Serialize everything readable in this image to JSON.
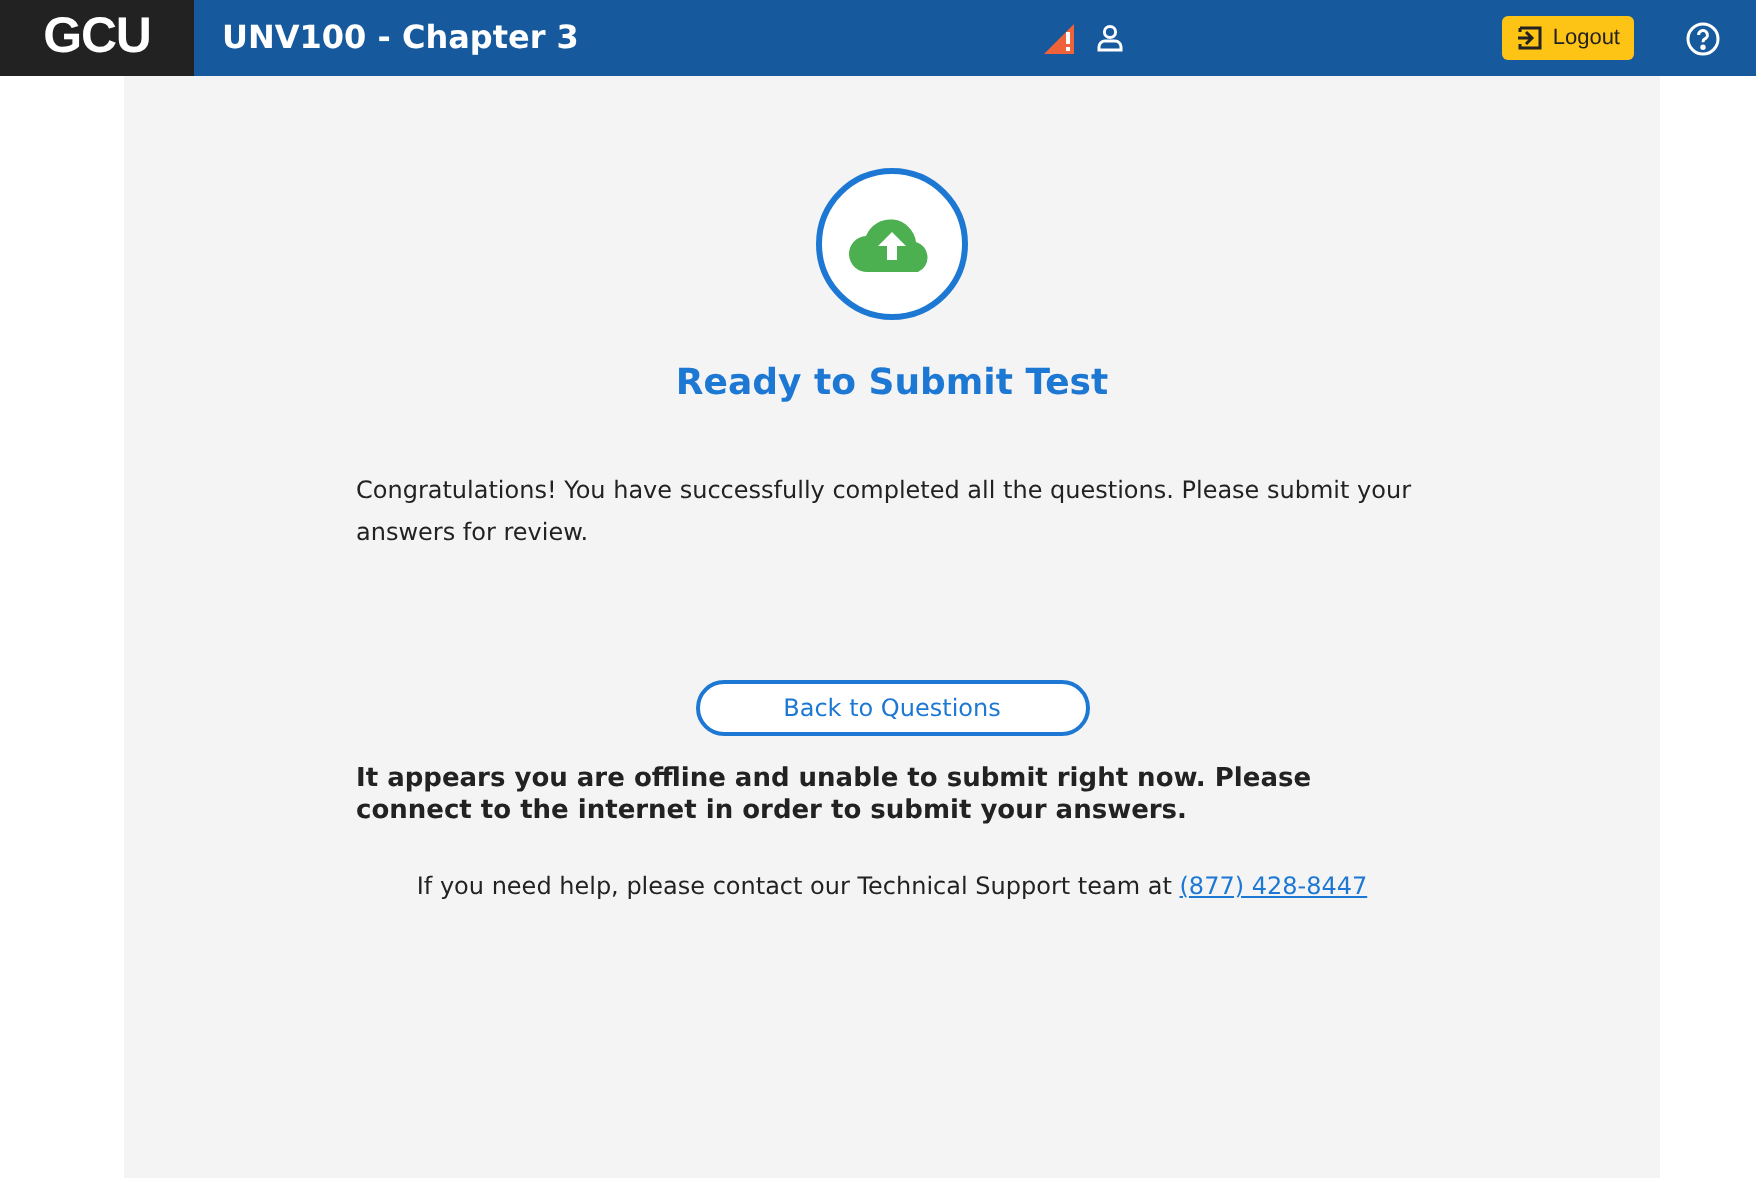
{
  "header": {
    "logo": "GCU",
    "title": "UNV100 - Chapter 3",
    "logout": "Logout"
  },
  "content": {
    "heading": "Ready to Submit Test",
    "message": "Congratulations! You have successfully completed all the questions. Please submit your answers for review.",
    "back_button": "Back to Questions",
    "offline_notice": "It appears you are offline and unable to submit right now. Please connect to the internet in order to submit your answers.",
    "help_text": "If you need help, please contact our Technical Support team at",
    "help_phone": "(877) 428-8447"
  }
}
